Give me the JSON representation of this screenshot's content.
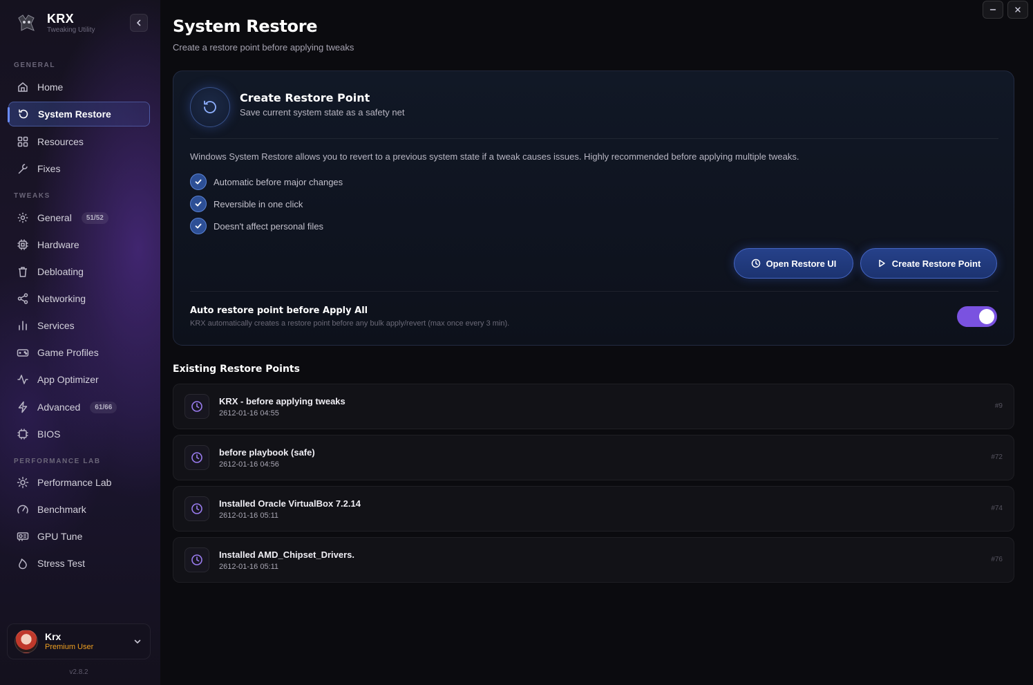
{
  "app": {
    "name": "KRX",
    "subtitle": "Tweaking Utility",
    "version": "v2.8.2"
  },
  "sidebar": {
    "sections": {
      "general": "GENERAL",
      "tweaks": "TWEAKS",
      "performance_lab": "PERFORMANCE LAB"
    },
    "items": [
      {
        "label": "Home",
        "icon": "home-icon"
      },
      {
        "label": "System Restore",
        "icon": "restore-icon",
        "active": true
      },
      {
        "label": "Resources",
        "icon": "grid-icon"
      },
      {
        "label": "Fixes",
        "icon": "wrench-icon"
      },
      {
        "label": "General",
        "icon": "gear-icon",
        "badge": "51/52"
      },
      {
        "label": "Hardware",
        "icon": "chip-icon"
      },
      {
        "label": "Debloating",
        "icon": "trash-icon"
      },
      {
        "label": "Networking",
        "icon": "share-icon"
      },
      {
        "label": "Services",
        "icon": "bar-chart-icon"
      },
      {
        "label": "Game Profiles",
        "icon": "gamepad-icon"
      },
      {
        "label": "App Optimizer",
        "icon": "activity-icon"
      },
      {
        "label": "Advanced",
        "icon": "bolt-icon",
        "badge": "61/66"
      },
      {
        "label": "BIOS",
        "icon": "cpu-icon"
      },
      {
        "label": "Performance Lab",
        "icon": "sun-icon"
      },
      {
        "label": "Benchmark",
        "icon": "gauge-icon"
      },
      {
        "label": "GPU Tune",
        "icon": "gpu-icon"
      },
      {
        "label": "Stress Test",
        "icon": "flame-icon"
      }
    ]
  },
  "user": {
    "name": "Krx",
    "role": "Premium User"
  },
  "page": {
    "title": "System Restore",
    "subtitle": "Create a restore point before applying tweaks"
  },
  "card": {
    "title": "Create Restore Point",
    "subtitle": "Save current system state as a safety net",
    "description": "Windows System Restore allows you to revert to a previous system state if a tweak causes issues. Highly recommended before applying multiple tweaks.",
    "features": [
      "Automatic before major changes",
      "Reversible in one click",
      "Doesn't affect personal files"
    ],
    "open_button": "Open Restore UI",
    "create_button": "Create Restore Point",
    "auto_title": "Auto restore point before Apply All",
    "auto_sub": "KRX automatically creates a restore point before any bulk apply/revert (max once every 3 min).",
    "auto_enabled": true
  },
  "restore_points": {
    "title": "Existing Restore Points",
    "items": [
      {
        "name": "KRX - before applying tweaks",
        "date": "2612-01-16 04:55",
        "id": "#9"
      },
      {
        "name": "before playbook (safe)",
        "date": "2612-01-16 04:56",
        "id": "#72"
      },
      {
        "name": "Installed Oracle VirtualBox 7.2.14",
        "date": "2612-01-16 05:11",
        "id": "#74"
      },
      {
        "name": "Installed AMD_Chipset_Drivers.",
        "date": "2612-01-16 05:11",
        "id": "#76"
      }
    ]
  },
  "colors": {
    "accent": "#7a52e0",
    "primary_button": "#26418a",
    "premium": "#f0a020"
  }
}
